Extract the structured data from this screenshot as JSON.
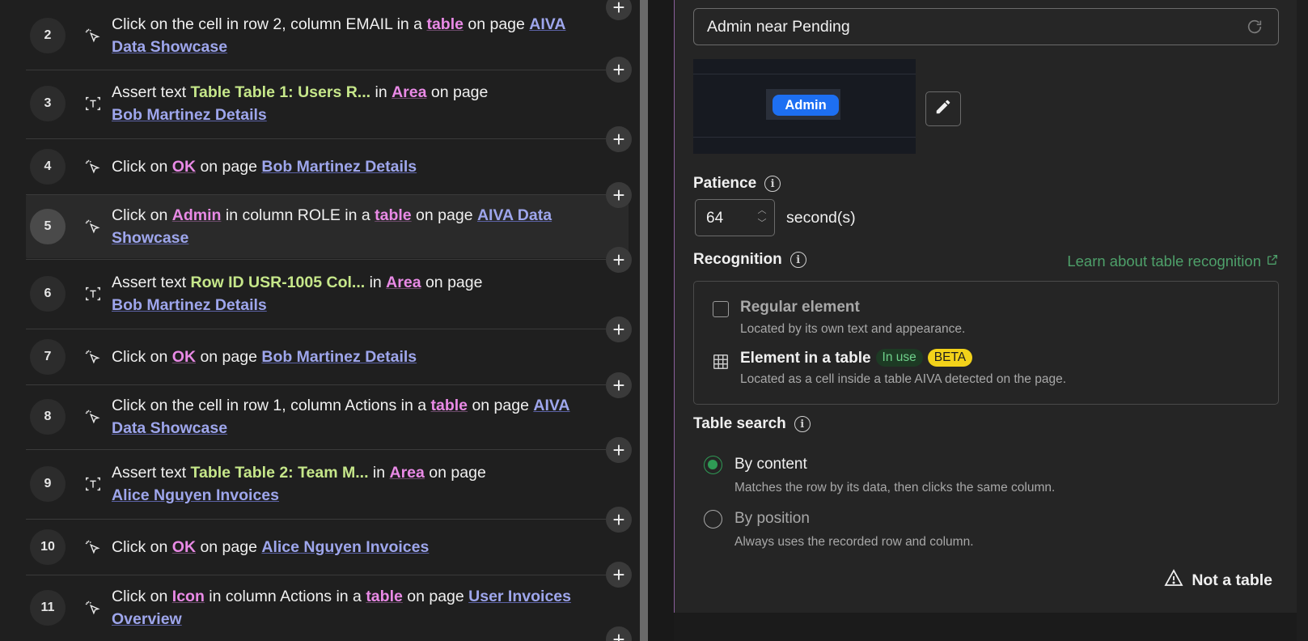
{
  "steps": [
    {
      "num": "2",
      "icon": "click-icon",
      "parts": [
        {
          "t": "Click on the cell in row 2, column EMAIL in a "
        },
        {
          "t": "table",
          "s": "pink"
        },
        {
          "t": " on page "
        },
        {
          "t": "AIVA Data Showcase",
          "s": "page"
        }
      ]
    },
    {
      "num": "3",
      "icon": "text-assert-icon",
      "parts": [
        {
          "t": "Assert text "
        },
        {
          "t": "Table Table 1: Users R...",
          "s": "green"
        },
        {
          "t": "  in "
        },
        {
          "t": "Area",
          "s": "pink"
        },
        {
          "t": " on page "
        },
        {
          "br": true
        },
        {
          "t": "Bob Martinez Details",
          "s": "page"
        }
      ]
    },
    {
      "num": "4",
      "icon": "click-icon",
      "parts": [
        {
          "t": "Click on "
        },
        {
          "t": "OK",
          "s": "pink"
        },
        {
          "t": " on page "
        },
        {
          "t": "Bob Martinez Details",
          "s": "page"
        }
      ]
    },
    {
      "num": "5",
      "icon": "click-icon",
      "active": true,
      "parts": [
        {
          "t": "Click on "
        },
        {
          "t": "Admin",
          "s": "pink"
        },
        {
          "t": " in column ROLE in a "
        },
        {
          "t": "table",
          "s": "pink"
        },
        {
          "t": " on page "
        },
        {
          "t": "AIVA Data Showcase",
          "s": "page"
        }
      ]
    },
    {
      "num": "6",
      "icon": "text-assert-icon",
      "parts": [
        {
          "t": "Assert text "
        },
        {
          "t": "Row ID USR-1005 Col...",
          "s": "green"
        },
        {
          "t": "  in "
        },
        {
          "t": "Area",
          "s": "pink"
        },
        {
          "t": " on page "
        },
        {
          "br": true
        },
        {
          "t": "Bob Martinez Details",
          "s": "page"
        }
      ]
    },
    {
      "num": "7",
      "icon": "click-icon",
      "parts": [
        {
          "t": "Click on "
        },
        {
          "t": "OK",
          "s": "pink"
        },
        {
          "t": " on page "
        },
        {
          "t": "Bob Martinez Details",
          "s": "page"
        }
      ]
    },
    {
      "num": "8",
      "icon": "click-icon",
      "parts": [
        {
          "t": "Click on the cell in row 1, column Actions in a "
        },
        {
          "t": "table",
          "s": "pink"
        },
        {
          "t": " on page "
        },
        {
          "t": "AIVA Data Showcase",
          "s": "page"
        }
      ]
    },
    {
      "num": "9",
      "icon": "text-assert-icon",
      "parts": [
        {
          "t": "Assert text "
        },
        {
          "t": "Table Table 2: Team M...",
          "s": "green"
        },
        {
          "t": " in "
        },
        {
          "t": "Area",
          "s": "pink"
        },
        {
          "t": " on page "
        },
        {
          "br": true
        },
        {
          "t": "Alice Nguyen Invoices",
          "s": "page"
        }
      ]
    },
    {
      "num": "10",
      "icon": "click-icon",
      "parts": [
        {
          "t": "Click on "
        },
        {
          "t": "OK",
          "s": "pink"
        },
        {
          "t": " on page "
        },
        {
          "t": "Alice Nguyen Invoices",
          "s": "page"
        }
      ]
    },
    {
      "num": "11",
      "icon": "click-icon",
      "parts": [
        {
          "t": "Click on "
        },
        {
          "t": "Icon",
          "s": "pink"
        },
        {
          "t": " in column Actions in a "
        },
        {
          "t": "table",
          "s": "pink"
        },
        {
          "t": " on page "
        },
        {
          "t": "User Invoices Overview",
          "s": "page"
        }
      ]
    }
  ],
  "panel": {
    "selector_text": "Admin near Pending",
    "preview_badge": "Admin",
    "patience_label": "Patience",
    "patience_value": "64",
    "patience_unit": "second(s)",
    "recognition_label": "Recognition",
    "learn_link": "Learn about table recognition",
    "regular_title": "Regular element",
    "regular_desc": "Located by its own text and appearance.",
    "table_title": "Element in a table",
    "in_use": "In use",
    "beta": "BETA",
    "table_desc": "Located as a cell inside a table AIVA detected on the page.",
    "table_search_label": "Table search",
    "by_content_title": "By content",
    "by_content_desc": "Matches the row by its data, then clicks the same column.",
    "by_position_title": "By position",
    "by_position_desc": "Always uses the recorded row and column.",
    "not_table": "Not a table"
  },
  "colors": {
    "accent_pink": "#e98ae6",
    "accent_green": "#c6e78a",
    "page_link": "#9ea6ec",
    "radio_green": "#2f9a55",
    "beta_yellow": "#f2d21a",
    "blue_badge": "#1d6ff2"
  }
}
